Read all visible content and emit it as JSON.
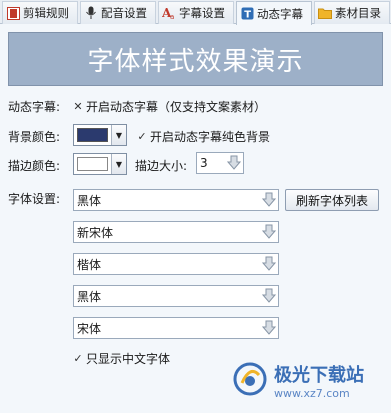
{
  "tabs": [
    {
      "label": "剪辑规则",
      "icon": "film-icon",
      "active": false
    },
    {
      "label": "配音设置",
      "icon": "microphone-icon",
      "active": false
    },
    {
      "label": "字幕设置",
      "icon": "subtitle-icon",
      "active": false
    },
    {
      "label": "动态字幕",
      "icon": "text-t-icon",
      "active": true
    },
    {
      "label": "素材目录",
      "icon": "folder-icon",
      "active": false
    }
  ],
  "banner": {
    "text": "字体样式效果演示"
  },
  "dynamic": {
    "label": "动态字幕:",
    "checkbox_label": "开启动态字幕（仅支持文案素材）",
    "checked": false
  },
  "background": {
    "label": "背景颜色:",
    "color": "#2b3a6e",
    "checkbox_label": "开启动态字幕纯色背景",
    "checked": true
  },
  "stroke": {
    "label": "描边颜色:",
    "color": "#ffffff",
    "size_label": "描边大小:",
    "size_value": "3"
  },
  "fonts": {
    "label": "字体设置:",
    "refresh_button": "刷新字体列表",
    "items": [
      "黑体",
      "新宋体",
      "楷体",
      "黑体",
      "宋体"
    ]
  },
  "chinese_only": {
    "label": "只显示中文字体",
    "checked": true
  },
  "watermark": {
    "title": "极光下载站",
    "url": "www.xz7.com"
  }
}
